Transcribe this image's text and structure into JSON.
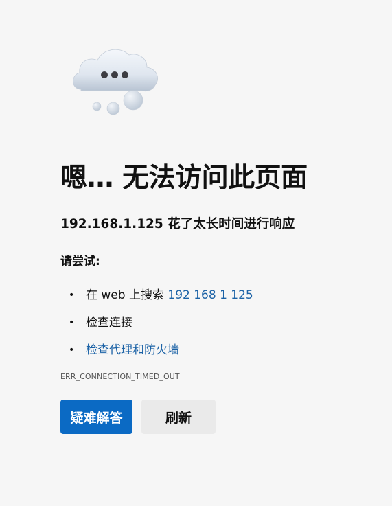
{
  "illustration": {
    "icon": "cloud-with-ellipsis-icon"
  },
  "error_page": {
    "heading": "嗯… 无法访问此页面",
    "subheading": "192.168.1.125 花了太长时间进行响应",
    "try_label": "请尝试:",
    "suggestions": [
      {
        "prefix": "在 web 上搜索 ",
        "link": "192 168 1 125"
      },
      {
        "text": "检查连接"
      },
      {
        "link": "检查代理和防火墙"
      }
    ],
    "error_code": "ERR_CONNECTION_TIMED_OUT"
  },
  "buttons": {
    "troubleshoot_label": "疑难解答",
    "refresh_label": "刷新"
  },
  "colors": {
    "background": "#f6f6f6",
    "link": "#1b62a6",
    "primary_button": "#0b6ac4",
    "secondary_button": "#eaeaea"
  }
}
